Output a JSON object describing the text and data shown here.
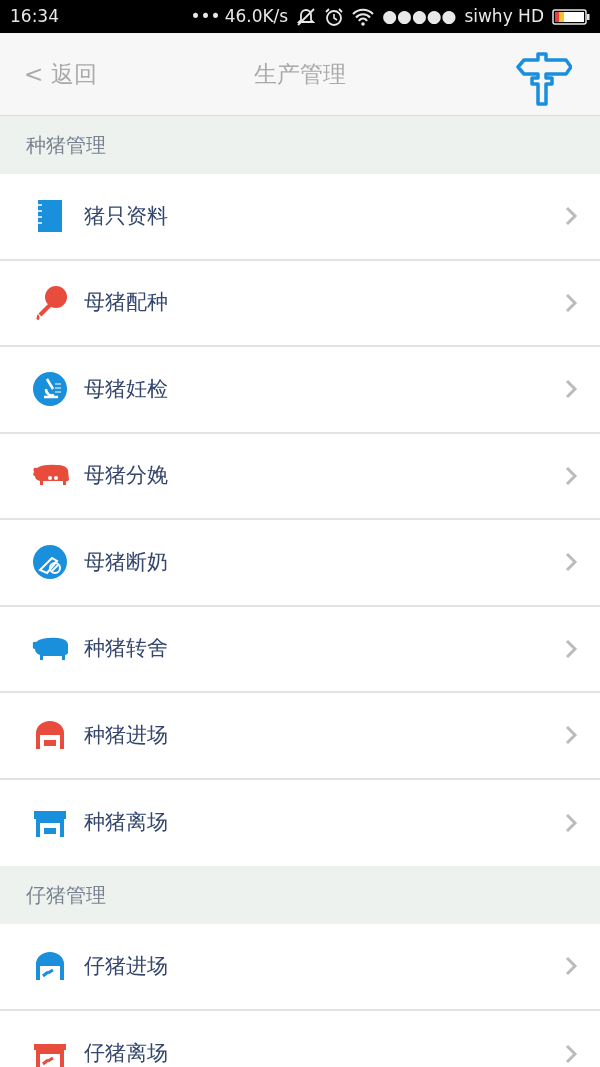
{
  "status_bar": {
    "time": "16:34",
    "dots": "•••",
    "speed": "46.0K/s",
    "signal": "●●●●●",
    "carrier": "siwhy HD"
  },
  "header": {
    "back": "< 返回",
    "title": "生产管理"
  },
  "sections": [
    {
      "title": "种猪管理",
      "items": [
        {
          "label": "猪只资料",
          "kind": "book",
          "color": "#1a8fdc"
        },
        {
          "label": "母猪配种",
          "kind": "dropper",
          "color": "#e84c3d"
        },
        {
          "label": "母猪妊检",
          "kind": "microscope",
          "color": "#1a8fdc"
        },
        {
          "label": "母猪分娩",
          "kind": "sow",
          "color": "#e84c3d"
        },
        {
          "label": "母猪断奶",
          "kind": "bottle",
          "color": "#1a8fdc"
        },
        {
          "label": "种猪转舍",
          "kind": "pig",
          "color": "#1a8fdc"
        },
        {
          "label": "种猪进场",
          "kind": "barn-round",
          "color": "#e84c3d"
        },
        {
          "label": "种猪离场",
          "kind": "barn-flat",
          "color": "#1a8fdc"
        }
      ]
    },
    {
      "title": "仔猪管理",
      "items": [
        {
          "label": "仔猪进场",
          "kind": "piglet-barn-round",
          "color": "#1a8fdc"
        },
        {
          "label": "仔猪离场",
          "kind": "piglet-barn-flat",
          "color": "#e84c3d"
        }
      ]
    }
  ]
}
